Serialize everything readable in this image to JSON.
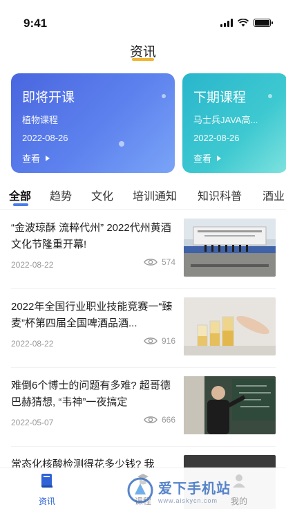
{
  "status_bar": {
    "time": "9:41"
  },
  "page": {
    "title": "资讯",
    "accent_color": "#f0b433"
  },
  "cards": [
    {
      "heading": "即将开课",
      "subtitle": "植物课程",
      "date": "2022-08-26",
      "more_label": "查看"
    },
    {
      "heading": "下期课程",
      "subtitle": "马士兵JAVA高...",
      "date": "2022-08-26",
      "more_label": "查看"
    }
  ],
  "tabs": [
    {
      "label": "全部",
      "active": true
    },
    {
      "label": "趋势",
      "active": false
    },
    {
      "label": "文化",
      "active": false
    },
    {
      "label": "培训通知",
      "active": false
    },
    {
      "label": "知识科普",
      "active": false
    },
    {
      "label": "酒业",
      "active": false
    }
  ],
  "news": [
    {
      "title": "“金波琼酥 流粹代州” 2022代州黄酒文化节隆重开幕!",
      "date": "2022-08-22",
      "views": "574",
      "thumb_icon": "event-stage-photo"
    },
    {
      "title": "2022年全国行业职业技能竞赛一“臻麦”杯第四届全国啤酒品酒...",
      "date": "2022-08-22",
      "views": "916",
      "thumb_icon": "beer-glasses-photo"
    },
    {
      "title": "难倒6个博士的问题有多难? 超哥德巴赫猜想, “韦神”一夜搞定",
      "date": "2022-05-07",
      "views": "666",
      "thumb_icon": "lecturer-blackboard-photo"
    },
    {
      "title": "常态化核酸检测得花多少钱? 我",
      "date": "",
      "views": "",
      "thumb_icon": "dark-photo"
    }
  ],
  "bottom_nav": [
    {
      "label": "资讯",
      "icon": "news-book-icon",
      "active": true
    },
    {
      "label": "课程",
      "icon": "course-icon",
      "active": false
    },
    {
      "label": "我的",
      "icon": "profile-icon",
      "active": false
    }
  ],
  "watermark": {
    "main": "爱下手机站",
    "sub": "www.aiskycn.com"
  }
}
